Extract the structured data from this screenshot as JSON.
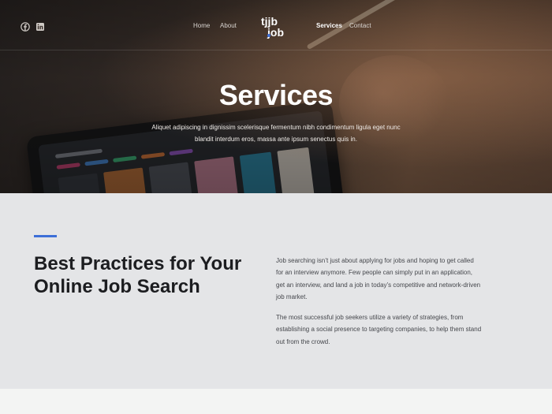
{
  "nav": {
    "left_links": [
      {
        "label": "Home"
      },
      {
        "label": "About"
      }
    ],
    "right_links": [
      {
        "label": "Services"
      },
      {
        "label": "Contact"
      }
    ],
    "logo_text": "tjjb job",
    "social_icons": [
      "facebook-icon",
      "linkedin-icon"
    ]
  },
  "hero": {
    "title": "Services",
    "subtitle": "Aliquet adipiscing in dignissim scelerisque fermentum nibh condimentum ligula eget nunc blandit interdum eros, massa ante ipsum senectus quis in."
  },
  "content": {
    "heading": "Best Practices for Your Online Job Search",
    "paragraph1": "Job searching isn’t just about applying for jobs and hoping to get called for an interview anymore. Few people can simply put in an application, get an interview, and land a job in today’s competitive and network-driven job market.",
    "paragraph2": "The most successful job seekers utilize a variety of strategies, from establishing a social presence to targeting companies, to help them stand out from the crowd."
  },
  "colors": {
    "accent": "#3d6fd8",
    "heading": "#1c1d20",
    "body_text": "#45474c",
    "section_bg": "#e4e5e7"
  }
}
